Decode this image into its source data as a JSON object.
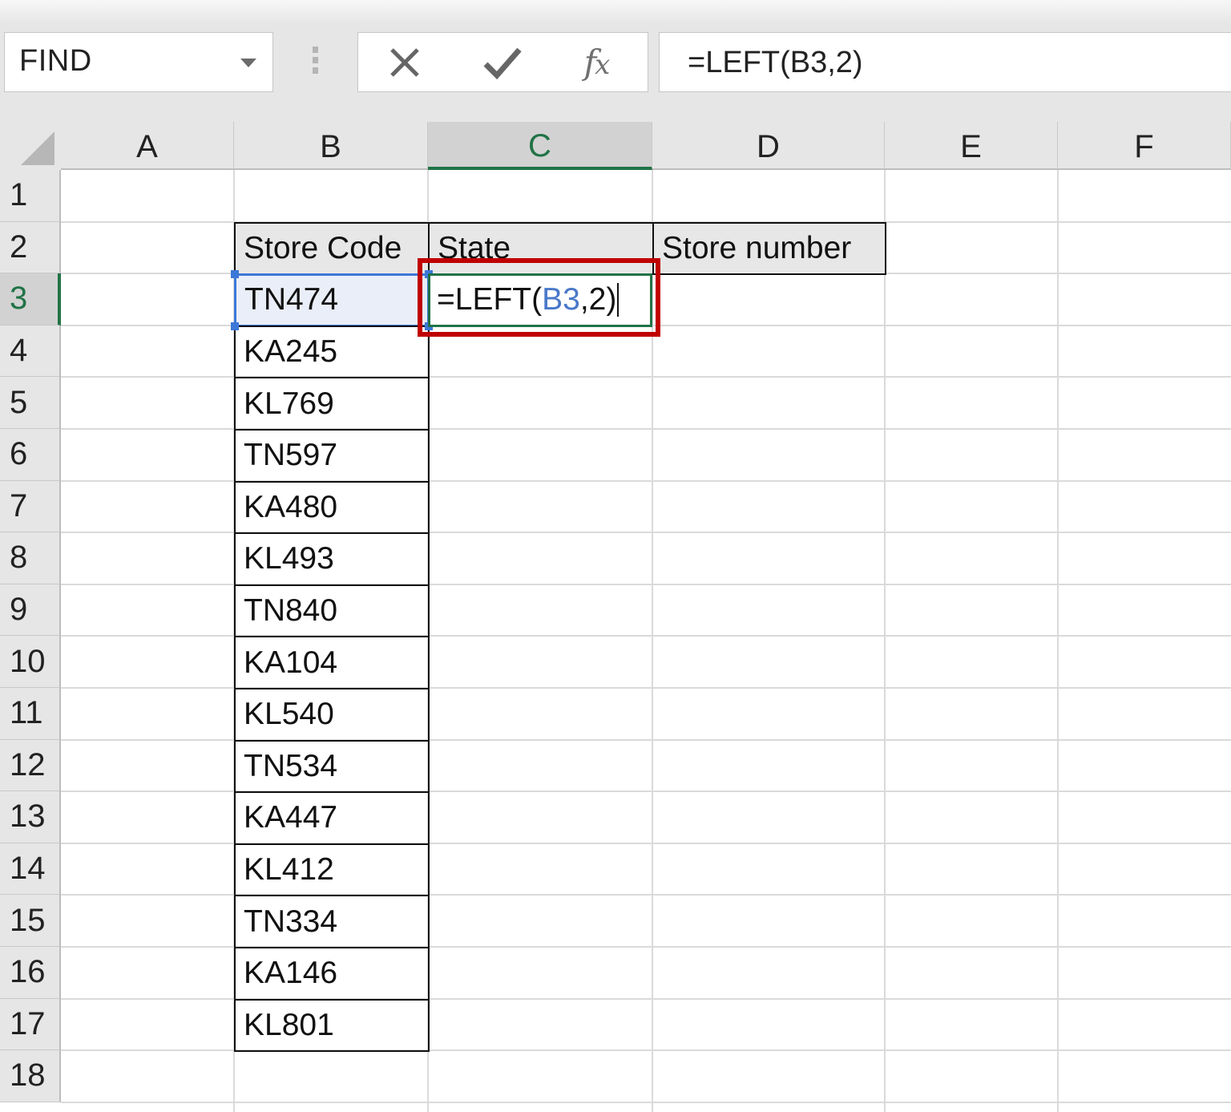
{
  "formula_bar": {
    "name_box": "FIND",
    "name_box_dropdown_icon": "chevron-down-icon",
    "cancel_icon": "close-icon",
    "enter_icon": "check-icon",
    "function_icon": "fx-icon",
    "fx_label": "f",
    "fx_sub": "x",
    "formula": "=LEFT(B3,2)"
  },
  "sheet": {
    "columns": [
      "A",
      "B",
      "C",
      "D",
      "E",
      "F"
    ],
    "active_column": "C",
    "rows": [
      "1",
      "2",
      "3",
      "4",
      "5",
      "6",
      "7",
      "8",
      "9",
      "10",
      "11",
      "12",
      "13",
      "14",
      "15",
      "16",
      "17",
      "18"
    ],
    "active_row": "3",
    "headers": {
      "B2": "Store Code",
      "C2": "State",
      "D2": "Store number"
    },
    "store_codes": [
      "TN474",
      "KA245",
      "KL769",
      "TN597",
      "KA480",
      "KL493",
      "TN840",
      "KA104",
      "KL540",
      "TN534",
      "KA447",
      "KL412",
      "TN334",
      "KA146",
      "KL801"
    ],
    "editing_cell": {
      "address": "C3",
      "prefix": "=LEFT(",
      "reference": "B3",
      "suffix": ",2)"
    }
  },
  "colors": {
    "accent_green": "#217346",
    "reference_blue": "#3c78d8",
    "highlight_red": "#c00000"
  }
}
